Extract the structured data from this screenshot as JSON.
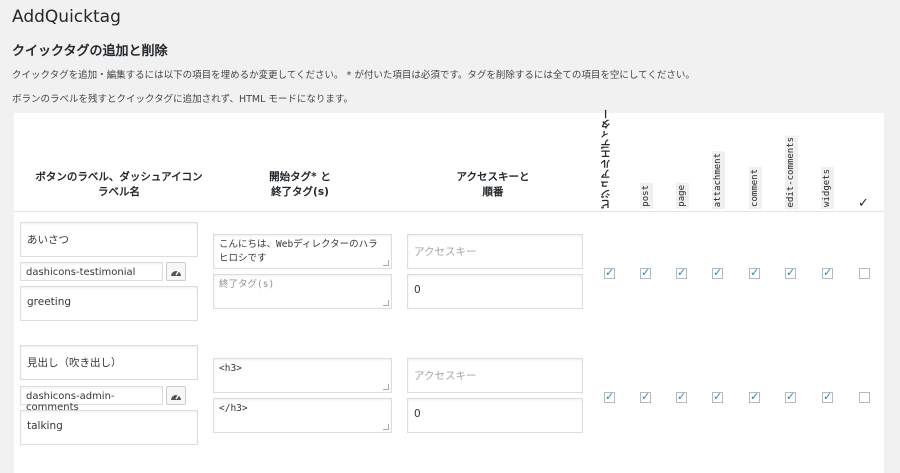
{
  "page": {
    "title": "AddQuicktag",
    "section_title": "クイックタグの追加と削除",
    "description_1": "クイックタグを追加・編集するには以下の項目を埋めるか変更してください。 * が付いた項目は必須です。タグを削除するには全ての項目を空にしてください。",
    "description_2": "ボランのラベルを残すとクイックタグに追加されず、HTML モードになります。"
  },
  "table": {
    "headers": {
      "button_label_l1": "ボタンのラベル、ダッシュアイコン",
      "button_label_l2": "ラベル名",
      "tags_l1": "開始タグ* と",
      "tags_l2": "終了タグ(s)",
      "access_l1": "アクセスキーと",
      "access_l2": "順番",
      "visual_editor": "ビジュアルエディター",
      "post": "post",
      "page": "page",
      "attachment": "attachment",
      "comment": "comment",
      "edit_comments": "edit-comments",
      "widgets": "widgets",
      "select_all_icon": "checkmark-icon"
    },
    "rows": [
      {
        "button_label": "あいさつ",
        "dashicon": "dashicons-testimonial",
        "title": "greeting",
        "start_tag": "こんにちは、Webディレクターのハラヒロシです",
        "end_tag_placeholder": "終了タグ(s)",
        "end_tag": "",
        "access_key_placeholder": "アクセスキー",
        "order": "0",
        "checks": [
          true,
          true,
          true,
          true,
          true,
          true,
          true,
          false
        ]
      },
      {
        "button_label": "見出し（吹き出し）",
        "dashicon": "dashicons-admin-comments",
        "title": "talking",
        "start_tag": "<h3>",
        "end_tag_placeholder": "",
        "end_tag": "</h3>",
        "access_key_placeholder": "アクセスキー",
        "order": "0",
        "checks": [
          true,
          true,
          true,
          true,
          true,
          true,
          true,
          false
        ]
      }
    ]
  },
  "colors": {
    "check": "#1e8cbe",
    "background": "#f1f1f1",
    "panel": "#ffffff"
  }
}
